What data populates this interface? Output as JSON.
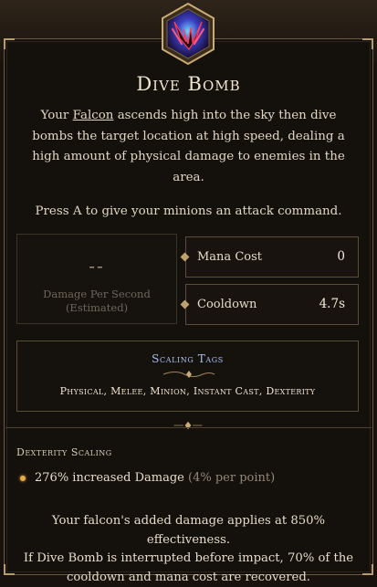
{
  "skill": {
    "name": "Dive Bomb",
    "desc_pre": "Your ",
    "desc_link": "Falcon",
    "desc_post": " ascends high into the sky then dive bombs the target location at high speed, dealing a high amount of physical damage to enemies in the area.",
    "command_hint": "Press A to give your minions an attack command."
  },
  "dps": {
    "value": "--",
    "label_line1": "Damage Per Second",
    "label_line2": "(Estimated)"
  },
  "stats": {
    "mana_label": "Mana Cost",
    "mana_value": "0",
    "cooldown_label": "Cooldown",
    "cooldown_value": "4.7s"
  },
  "scaling_tags": {
    "title": "Scaling Tags",
    "list": "Physical, Melee, Minion, Instant Cast, Dexterity"
  },
  "dexterity_scaling": {
    "header": "Dexterity Scaling",
    "bonus": "276% increased Damage",
    "note": "(4% per point)"
  },
  "footer": {
    "line1": "Your falcon's added damage applies at 850% effectiveness.",
    "line2": "If Dive Bomb is interrupted before impact, 70% of the",
    "line3": "cooldown and mana cost are recovered."
  },
  "icons": {
    "skill": "dive-bomb-falcon-icon"
  },
  "colors": {
    "background": "#14100c",
    "border_gold": "#b79c6d",
    "tag_title": "#a9c0f2",
    "bullet": "#e6a94a"
  }
}
